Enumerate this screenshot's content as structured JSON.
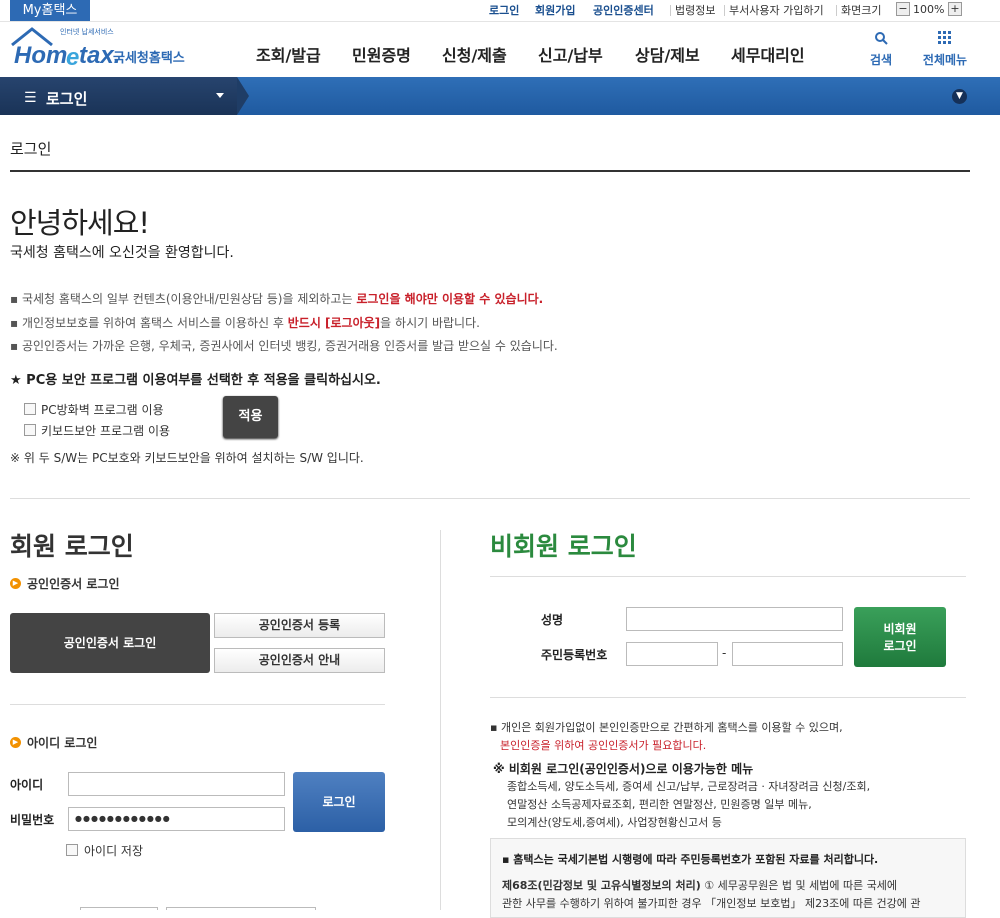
{
  "util": {
    "myhome": "My홈택스",
    "links_blue": [
      "로그인",
      "회원가입",
      "공인인증센터"
    ],
    "links_gray": [
      "법령정보",
      "부서사용자 가입하기",
      "화면크기"
    ],
    "zoom_minus": "−",
    "zoom_value": "100%",
    "zoom_plus": "+"
  },
  "logo": {
    "tagline": "인터넷 납세서비스",
    "brand": "Hometax",
    "name": "국세청홈택스"
  },
  "gnb": {
    "menus": [
      "조회/발급",
      "민원증명",
      "신청/제출",
      "신고/납부",
      "상담/제보",
      "세무대리인"
    ],
    "search_label": "검색",
    "allmenu_label": "전체메뉴"
  },
  "location": {
    "current": "로그인"
  },
  "page": {
    "title": "로그인",
    "hello": "안녕하세요!",
    "welcome": "국세청 홈택스에 오신것을 환영합니다.",
    "notice1_a": "국세청 홈택스의 일부 컨텐츠(이용안내/민원상담 등)을 제외하고는 ",
    "notice1_b": "로그인을 해야만 이용할 수 있습니다.",
    "notice2_a": "개인정보보호를 위하여 홈택스 서비스를 이용하신 후 ",
    "notice2_b": "반드시 [로그아웃]",
    "notice2_c": "을 하시기 바랍니다.",
    "notice3": "공인인증서는 가까운 은행, 우체국, 증권사에서 인터넷 뱅킹, 증권거래용 인증서를 발급 받으실 수 있습니다.",
    "pc_question": "★ PC용 보안 프로그램 이용여부를 선택한 후 적용을 클릭하십시오.",
    "firewall_label": "PC방화벽 프로그램 이용",
    "keyboard_label": "키보드보안 프로그램 이용",
    "apply_button": "적용",
    "sw_note": "※ 위 두 S/W는 PC보호와 키보드보안을 위하여 설치하는 S/W 입니다."
  },
  "member": {
    "title": "회원 로그인",
    "cert_section": "공인인증서 로그인",
    "cert_login_button": "공인인증서 로그인",
    "cert_register_button": "공인인증서 등록",
    "cert_guide_button": "공인인증서 안내",
    "id_section": "아이디 로그인",
    "id_label": "아이디",
    "id_value": "",
    "pw_label": "비밀번호",
    "pw_value": "●●●●●●●●●●●●",
    "login_button": "로그인",
    "save_id_label": "아이디 저장"
  },
  "nonmember": {
    "title": "비회원 로그인",
    "name_label": "성명",
    "rrn_label": "주민등록번호",
    "rrn_dash": "-",
    "login_button_line1": "비회원",
    "login_button_line2": "로그인",
    "desc1": "개인은 회원가입없이 본인인증만으로 간편하게 홈택스를 이용할 수 있으며,",
    "desc2": "본인인증을 위하여 공인인증서가 필요합니다.",
    "menu_title": "※ 비회원 로그인(공인인증서)으로 이용가능한 메뉴",
    "menu1": "종합소득세, 양도소득세, 증여세 신고/납부, 근로장려금 · 자녀장려금 신청/조회,",
    "menu2": "연말정산 소득공제자료조회, 편리한 연말정산, 민원증명 일부 메뉴,",
    "menu3": "모의계산(양도세,증여세), 사업장현황신고서 등",
    "note_head": "홈택스는 국세기본법 시행령에 따라 주민등록번호가 포함된 자료를 처리합니다.",
    "note_b": "제68조(민감정보 및 고유식별정보의 처리)",
    "note_body1": " ① 세무공무원은 법 및 세법에 따른 국세에",
    "note_body2": "관한 사무를 수행하기 위하여 불가피한 경우 「개인정보 보호법」 제23조에 따른 건강에 관"
  },
  "colors": {
    "primary_blue": "#2d6ab4",
    "dark_navy": "#1a3357",
    "member_green": "#2b8a3e",
    "notice_red": "#c8202a",
    "section_orange": "#f29100"
  }
}
